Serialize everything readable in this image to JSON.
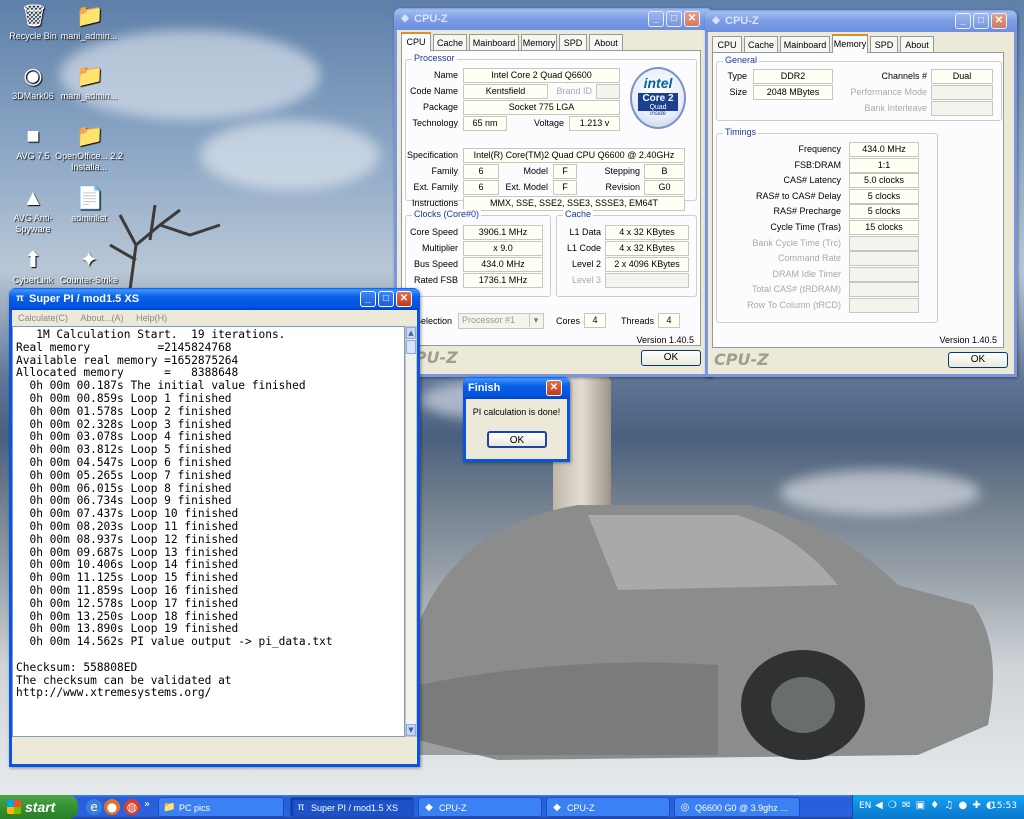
{
  "desktop": {
    "icons": [
      {
        "name": "desktop-icon-recycle-bin",
        "label": "Recycle Bin",
        "icon": "recycle-bin-icon",
        "glyph": "🗑"
      },
      {
        "name": "desktop-icon-mani-admin-1",
        "label": "mani_admin...",
        "icon": "folder-icon",
        "glyph": "📁"
      },
      {
        "name": "desktop-icon-3dmark06",
        "label": "3DMark06",
        "icon": "3dmark-icon",
        "glyph": "◉"
      },
      {
        "name": "desktop-icon-mani-admin-2",
        "label": "mani_admin...",
        "icon": "folder-icon",
        "glyph": "📁"
      },
      {
        "name": "desktop-icon-avg",
        "label": "AVG 7.5",
        "icon": "avg-icon",
        "glyph": "■"
      },
      {
        "name": "desktop-icon-openoffice",
        "label": "OpenOffice... 2.2 Installa...",
        "icon": "folder-icon",
        "glyph": "📁"
      },
      {
        "name": "desktop-icon-avg-antispyware",
        "label": "AVG Anti-Spyware",
        "icon": "avg-antispyware-icon",
        "glyph": "▲"
      },
      {
        "name": "desktop-icon-adminlist",
        "label": "adminlist",
        "icon": "document-icon",
        "glyph": "📄"
      },
      {
        "name": "desktop-icon-cyberlink",
        "label": "CyberLink",
        "icon": "cyberlink-icon",
        "glyph": "⬆"
      },
      {
        "name": "desktop-icon-counter-strike",
        "label": "Counter-Strike",
        "icon": "counter-strike-icon",
        "glyph": "✦"
      }
    ]
  },
  "cpuz_cpu": {
    "title": "CPU-Z",
    "tabs": [
      "CPU",
      "Cache",
      "Mainboard",
      "Memory",
      "SPD",
      "About"
    ],
    "selected_tab": "CPU",
    "processor": {
      "group": "Processor",
      "name_label": "Name",
      "name": "Intel Core 2 Quad Q6600",
      "codename_label": "Code Name",
      "codename": "Kentsfield",
      "brandid_label": "Brand ID",
      "package_label": "Package",
      "package": "Socket 775 LGA",
      "technology_label": "Technology",
      "technology": "65 nm",
      "voltage_label": "Voltage",
      "voltage": "1.213 v",
      "spec_label": "Specification",
      "spec": "Intel(R) Core(TM)2 Quad CPU    Q6600  @ 2.40GHz",
      "family_label": "Family",
      "family": "6",
      "model_label": "Model",
      "model": "F",
      "stepping_label": "Stepping",
      "stepping": "B",
      "extfamily_label": "Ext. Family",
      "extfamily": "6",
      "extmodel_label": "Ext. Model",
      "extmodel": "F",
      "revision_label": "Revision",
      "revision": "G0",
      "instructions_label": "Instructions",
      "instructions": "MMX, SSE, SSE2, SSE3, SSSE3, EM64T"
    },
    "intel_logo": {
      "brand": "intel",
      "product": "Core 2",
      "variant": "Quad",
      "tagline": "inside"
    },
    "clocks": {
      "group": "Clocks (Core#0)",
      "corespeed_label": "Core Speed",
      "corespeed": "3906.1 MHz",
      "multiplier_label": "Multiplier",
      "multiplier": "x 9.0",
      "busspeed_label": "Bus Speed",
      "busspeed": "434.0 MHz",
      "ratedfsb_label": "Rated FSB",
      "ratedfsb": "1736.1 MHz"
    },
    "cache": {
      "group": "Cache",
      "l1data_label": "L1 Data",
      "l1data": "4 x 32 KBytes",
      "l1code_label": "L1 Code",
      "l1code": "4 x 32 KBytes",
      "level2_label": "Level 2",
      "level2": "2 x 4096 KBytes",
      "level3_label": "Level 3"
    },
    "selection_label": "Selection",
    "selection": "Processor #1",
    "cores_label": "Cores",
    "cores": "4",
    "threads_label": "Threads",
    "threads": "4",
    "version": "Version 1.40.5",
    "logo": "CPU-Z",
    "ok": "OK"
  },
  "cpuz_mem": {
    "title": "CPU-Z",
    "tabs": [
      "CPU",
      "Cache",
      "Mainboard",
      "Memory",
      "SPD",
      "About"
    ],
    "selected_tab": "Memory",
    "general": {
      "group": "General",
      "type_label": "Type",
      "type": "DDR2",
      "size_label": "Size",
      "size": "2048 MBytes",
      "channels_label": "Channels #",
      "channels": "Dual",
      "perfmode_label": "Performance Mode",
      "bankinterleave_label": "Bank Interleave"
    },
    "timings": {
      "group": "Timings",
      "rows": [
        {
          "label": "Frequency",
          "value": "434.0 MHz",
          "dim": false
        },
        {
          "label": "FSB:DRAM",
          "value": "1:1",
          "dim": false
        },
        {
          "label": "CAS# Latency",
          "value": "5.0 clocks",
          "dim": false
        },
        {
          "label": "RAS# to CAS# Delay",
          "value": "5 clocks",
          "dim": false
        },
        {
          "label": "RAS# Precharge",
          "value": "5 clocks",
          "dim": false
        },
        {
          "label": "Cycle Time (Tras)",
          "value": "15 clocks",
          "dim": false
        },
        {
          "label": "Bank Cycle Time (Trc)",
          "value": "",
          "dim": true
        },
        {
          "label": "Command Rate",
          "value": "",
          "dim": true
        },
        {
          "label": "DRAM Idle Timer",
          "value": "",
          "dim": true
        },
        {
          "label": "Total CAS# (tRDRAM)",
          "value": "",
          "dim": true
        },
        {
          "label": "Row To Column (tRCD)",
          "value": "",
          "dim": true
        }
      ]
    },
    "version": "Version 1.40.5",
    "logo": "CPU-Z",
    "ok": "OK"
  },
  "superpi": {
    "title": "Super PI / mod1.5 XS",
    "menu": [
      "Calculate(C)",
      "About...(A)",
      "Help(H)"
    ],
    "output": [
      "   1M Calculation Start.  19 iterations.",
      "Real memory          =2145824768",
      "Available real memory =1652875264",
      "Allocated memory      =   8388648",
      "  0h 00m 00.187s The initial value finished",
      "  0h 00m 00.859s Loop 1 finished",
      "  0h 00m 01.578s Loop 2 finished",
      "  0h 00m 02.328s Loop 3 finished",
      "  0h 00m 03.078s Loop 4 finished",
      "  0h 00m 03.812s Loop 5 finished",
      "  0h 00m 04.547s Loop 6 finished",
      "  0h 00m 05.265s Loop 7 finished",
      "  0h 00m 06.015s Loop 8 finished",
      "  0h 00m 06.734s Loop 9 finished",
      "  0h 00m 07.437s Loop 10 finished",
      "  0h 00m 08.203s Loop 11 finished",
      "  0h 00m 08.937s Loop 12 finished",
      "  0h 00m 09.687s Loop 13 finished",
      "  0h 00m 10.406s Loop 14 finished",
      "  0h 00m 11.125s Loop 15 finished",
      "  0h 00m 11.859s Loop 16 finished",
      "  0h 00m 12.578s Loop 17 finished",
      "  0h 00m 13.250s Loop 18 finished",
      "  0h 00m 13.890s Loop 19 finished",
      "  0h 00m 14.562s PI value output -> pi_data.txt",
      "",
      "Checksum: 558808ED",
      "The checksum can be validated at",
      "http://www.xtremesystems.org/"
    ]
  },
  "finish_dialog": {
    "title": "Finish",
    "message": "PI calculation is done!",
    "ok": "OK"
  },
  "taskbar": {
    "start": "start",
    "quick_launch": [
      "ie-icon",
      "firefox-icon",
      "show-desktop-icon"
    ],
    "tasks": [
      {
        "name": "task-pc-pics",
        "label": "PC pics",
        "icon": "folder-icon",
        "glyph": "📁",
        "active": false
      },
      {
        "name": "task-superpi",
        "label": "Super PI / mod1.5 XS",
        "icon": "superpi-icon",
        "glyph": "π",
        "active": true
      },
      {
        "name": "task-cpuz-1",
        "label": "CPU-Z",
        "icon": "cpuz-icon",
        "glyph": "◆",
        "active": false
      },
      {
        "name": "task-cpuz-2",
        "label": "CPU-Z",
        "icon": "cpuz-icon",
        "glyph": "◆",
        "active": false
      },
      {
        "name": "task-q6600",
        "label": "Q6600 G0 @ 3.9ghz ...",
        "icon": "browser-icon",
        "glyph": "◎",
        "active": false
      }
    ],
    "language": "EN",
    "clock": "15:53"
  }
}
